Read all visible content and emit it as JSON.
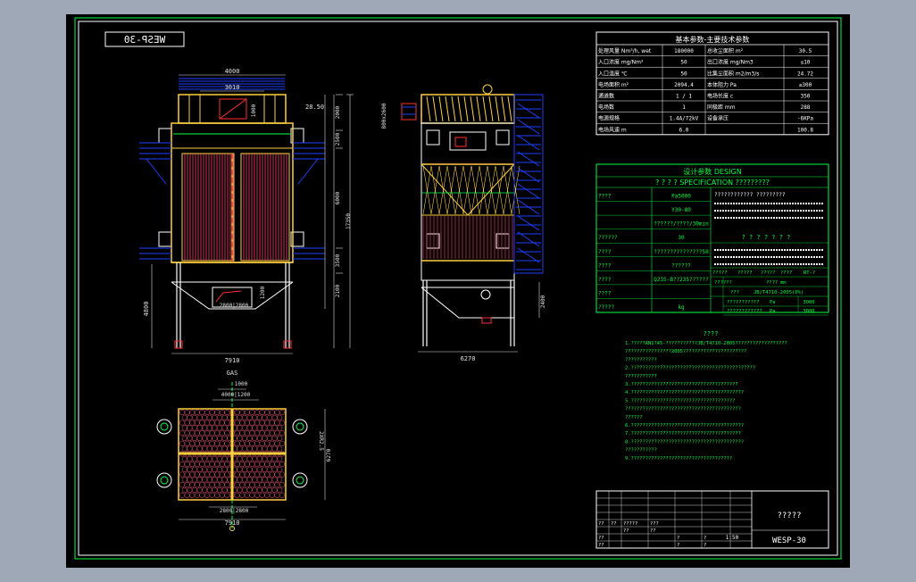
{
  "colors": {
    "background": "#9fa8b6",
    "canvas": "#000000",
    "frame_line": "#00ff40",
    "text_white": "#ffffff",
    "text_green": "#00ff40",
    "structure_yellow": "#ffd040",
    "electrode_red": "#d03060",
    "walkway_blue": "#2040ff",
    "dimension_white": "#e0e0e0"
  },
  "drawing_label": "WESP-30",
  "params_table": {
    "header": "基本参数-主要技术参数",
    "rows": [
      [
        "处理风量 Nm³/h, wet",
        "180000",
        "总收尘面积 m²",
        "30.5"
      ],
      [
        "入口浓度 mg/Nm³",
        "50",
        "出口浓度 mg/Nm3",
        "≤10"
      ],
      [
        "入口温度 ℃",
        "50",
        "比集尘面积 m2/m3/s",
        "24.72"
      ],
      [
        "电场面积 m²",
        "2094.4",
        "本体阻力 Pa",
        "≤300"
      ],
      [
        "通道数",
        "1 / 1",
        "电场长度 c",
        "350"
      ],
      [
        "电场数",
        "1",
        "同极距 mm",
        "288"
      ],
      [
        "电源规格",
        "1.4A/72kV",
        "设备承压",
        "-6KPa"
      ],
      [
        "电场风速 m",
        "6.0",
        "",
        "100.8"
      ]
    ]
  },
  "spec_table": {
    "title1": "设计参数 DESIGN",
    "title2": "? ? ? ? SPECIFICATION ?????????",
    "rows": [
      [
        "????",
        "Pa5000"
      ],
      [
        "",
        "Y30-80"
      ],
      [
        "",
        "??????/????/30min"
      ],
      [
        "??????",
        "30"
      ],
      [
        "????",
        "???????????????50"
      ],
      [
        "????",
        "??????"
      ],
      [
        "????",
        "Q235-B??235??????"
      ],
      [
        "????",
        ""
      ],
      [
        "?????",
        "kg"
      ]
    ],
    "right_block": {
      "line1": "???????????? ?????????",
      "line2": "? ? ? ? ? ? ?",
      "sub_labels": [
        "????? ",
        "?????",
        "?????",
        "????",
        "RT-?"
      ],
      "value_a": "??????",
      "value_b": "????",
      "unit_row1": "mm",
      "code": "JB/T4710-2005(0%)",
      "row_a_label": "???????????",
      "row_a_unit": "Pa",
      "row_a_value": "3000",
      "row_b_label": "????????????",
      "row_b_unit": "Pa",
      "row_b_value": "3000",
      "side_mark": "???"
    }
  },
  "notes": {
    "title": "????",
    "lines": [
      "1.?????AN1?45-???????????JB/T4710-2005??????????????????",
      "????????????????2005??????????????????????",
      "???????????",
      "2.???????????????????????????????????????????",
      "???????????",
      "3.?????????????????????????????????????",
      "4.???????????????????????????????????????",
      "5.????????????????????????????????????",
      "????????????????????????????????????????",
      "??????",
      "6.???????????????????????????????????????",
      "7.??????????????????????????????????????",
      "8.???????????????????????????????????????",
      "???????????",
      "9.???????????????????????????????????"
    ]
  },
  "title_block": {
    "project": "?????",
    "drawing_no": "WESP-30",
    "scale": "1:50",
    "cells": [
      "??",
      "??",
      "?????",
      "???",
      "??",
      "??",
      "??",
      "??",
      "?",
      "?",
      "?",
      "?"
    ]
  },
  "front_view": {
    "dims": {
      "top_width": "4000",
      "inner_width": "3010",
      "elev": "28.50",
      "right_dims": [
        "2000",
        "2500",
        "6000",
        "17350",
        "3500",
        "2100"
      ],
      "inner_height": "1000",
      "left_height": "4800",
      "hopper": "2800|2800",
      "total_width": "7910",
      "hopper_height": "1200"
    }
  },
  "side_view": {
    "dims": {
      "bottom_width": "6270",
      "top_left": "800x2600",
      "right_h": "2400"
    }
  },
  "plan_view": {
    "dims": {
      "top_label": "GAS",
      "width_top": "1000",
      "split": "4000|1200",
      "side": "2XR2.5",
      "height": "6270",
      "lower_split": "2800|2800",
      "total": "7910"
    }
  }
}
